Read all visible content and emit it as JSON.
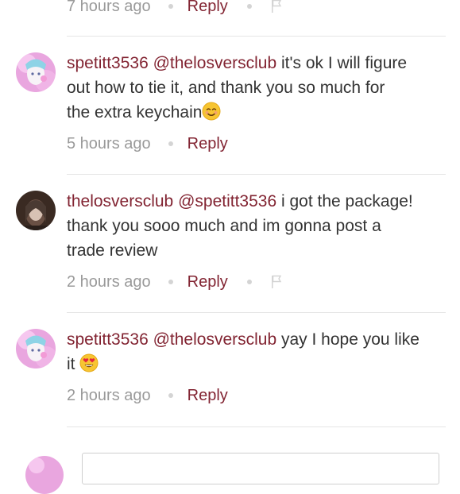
{
  "top_meta": {
    "time": "7 hours ago",
    "reply_label": "Reply",
    "flag_icon": "flag-icon"
  },
  "comments": [
    {
      "username": "spetitt3536",
      "mention": "@thelosversclub",
      "text_line1": " it's ok I will figure",
      "text_line2": "out how to tie it, and thank you so much for",
      "text_line3": "the extra keychain",
      "emoji": "smiling-face-icon",
      "time": "5 hours ago",
      "reply_label": "Reply"
    },
    {
      "username": "thelosversclub",
      "mention": "@spetitt3536",
      "text_line1": " i got the package!",
      "text_line2": "thank you sooo much and im gonna post a",
      "text_line3": "trade review",
      "time": "2 hours ago",
      "reply_label": "Reply",
      "flag_icon": "flag-icon"
    },
    {
      "username": "spetitt3536",
      "mention": "@thelosversclub",
      "text_line1": " yay I hope you like",
      "text_line2": "it ",
      "emoji": "heart-eyes-icon",
      "time": "2 hours ago",
      "reply_label": "Reply"
    }
  ],
  "colors": {
    "accent": "#822432",
    "muted": "#9a9a9a",
    "divider": "#e6e6e6"
  }
}
